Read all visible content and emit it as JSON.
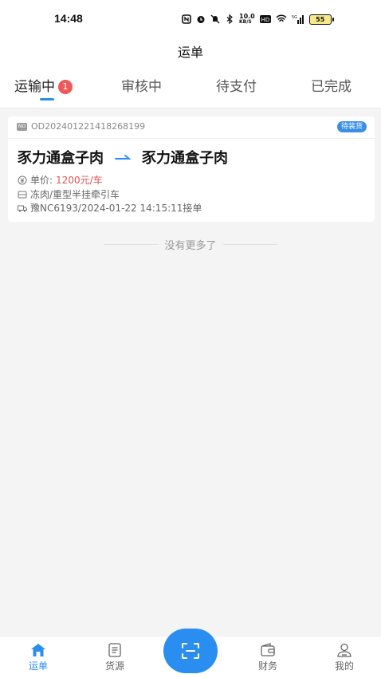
{
  "status_bar": {
    "time": "14:48",
    "net_speed": "10.0",
    "net_unit": "KB/S",
    "battery": "55"
  },
  "header": {
    "title": "运单"
  },
  "tabs": [
    {
      "label": "运输中",
      "badge": "1",
      "active": true
    },
    {
      "label": "审核中"
    },
    {
      "label": "待支付"
    },
    {
      "label": "已完成"
    }
  ],
  "orders": [
    {
      "order_icon_text": "NO",
      "order_no": "OD202401221418268199",
      "status": "待装货",
      "from": "豕力通盒子肉",
      "to": "豕力通盒子肉",
      "price_label": "单价:",
      "price_value": "1200元/车",
      "cargo_info": "冻肉/重型半挂牵引车",
      "vehicle_info": "豫NC6193/2024-01-22 14:15:11接单"
    }
  ],
  "list_footer": "没有更多了",
  "bottom_nav": [
    {
      "label": "运单",
      "icon": "home-icon",
      "active": true
    },
    {
      "label": "货源",
      "icon": "list-icon"
    },
    {
      "label": "",
      "icon": "scan-icon"
    },
    {
      "label": "财务",
      "icon": "wallet-icon"
    },
    {
      "label": "我的",
      "icon": "user-icon"
    }
  ],
  "colors": {
    "accent": "#2a8df0",
    "badge_red": "#ee5a5a",
    "price_red": "#e05454"
  }
}
